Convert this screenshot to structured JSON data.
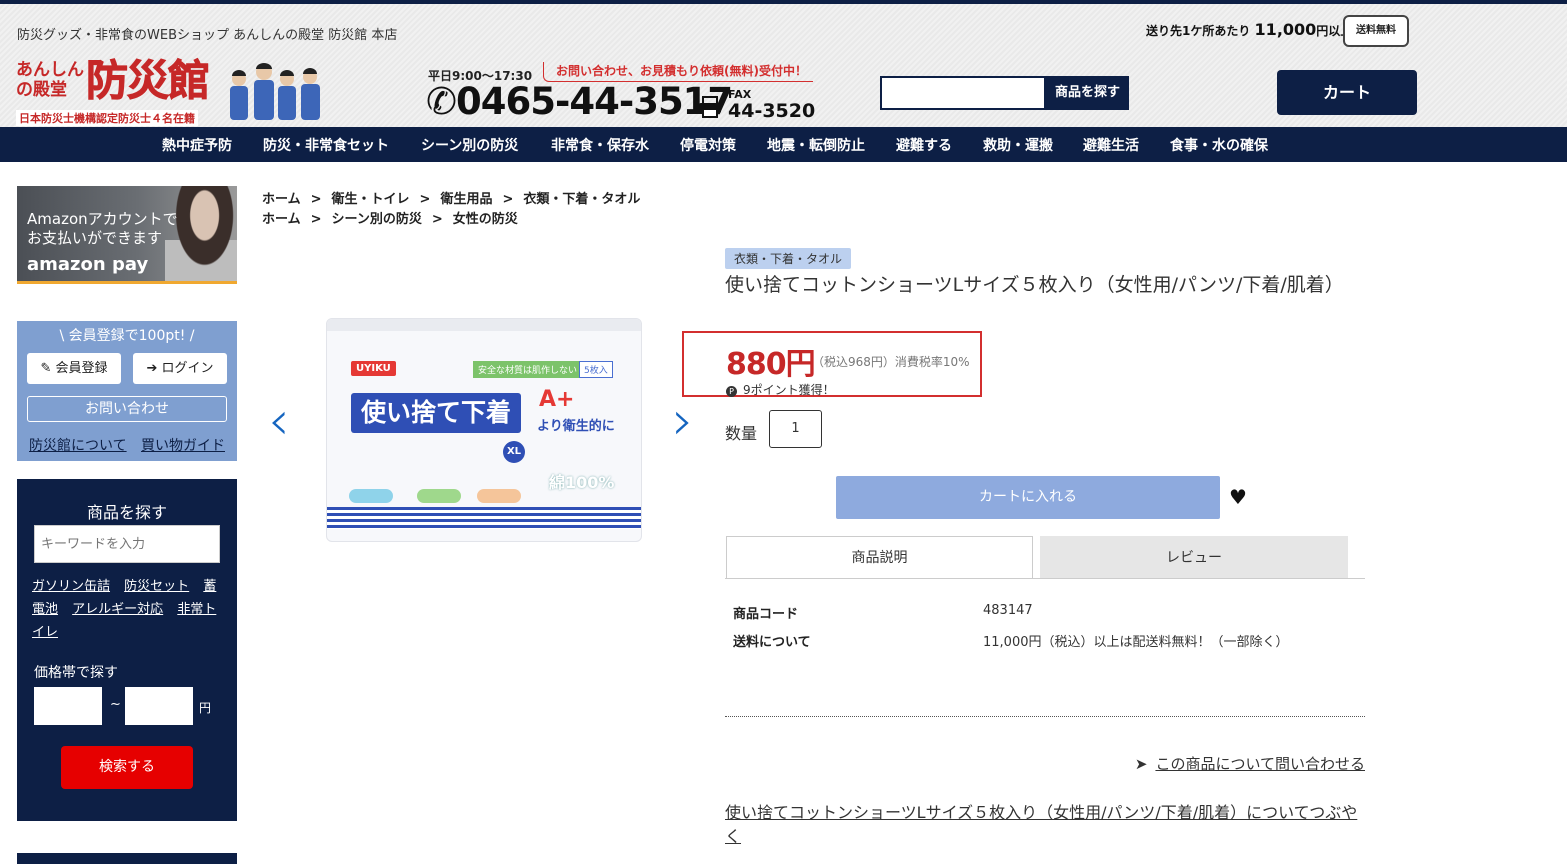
{
  "header": {
    "tagline": "防災グッズ・非常食のWEBショップ あんしんの殿堂 防災館 本店",
    "logo_small": "あんしんの殿堂",
    "logo_big": "防災館",
    "logo_sub": "日本防災士機構認定防災士４名在籍",
    "hours": "平日9:00〜17:30",
    "notice": "お問い合わせ、お見積もり依頼(無料)受付中！",
    "phone": "0465-44-3517",
    "fax_label": "FAX",
    "fax": "44-3520",
    "search_button": "商品を探す",
    "free_shipping_prefix": "送り先1ケ所あたり",
    "free_shipping_amount": "11,000",
    "free_shipping_suffix": "円以上で",
    "free_shipping_badge": "送料無料",
    "cart": "カート"
  },
  "nav": [
    "熱中症予防",
    "防災・非常食セット",
    "シーン別の防災",
    "非常食・保存水",
    "停電対策",
    "地震・転倒防止",
    "避難する",
    "救助・運搬",
    "避難生活",
    "食事・水の確保"
  ],
  "sidebar": {
    "amazon_line1": "Amazonアカウントで",
    "amazon_line2": "お支払いができます",
    "amazon_pay": "amazon pay",
    "member_title": "\\ 会員登録で100pt! /",
    "register": "会員登録",
    "login": "ログイン",
    "contact": "お問い合わせ",
    "about": "防災館について",
    "guide": "買い物ガイド",
    "find_title": "商品を探す",
    "keyword_placeholder": "キーワードを入力",
    "tags": [
      "ガソリン缶詰",
      "防災セット",
      "蓄電池",
      "アレルギー対応",
      "非常トイレ"
    ],
    "price_title": "価格帯で探す",
    "tilde": "~",
    "yen": "円",
    "search": "検索する"
  },
  "breadcrumbs": [
    [
      "ホーム",
      "衛生・トイレ",
      "衛生用品",
      "衣類・下着・タオル"
    ],
    [
      "ホーム",
      "シーン別の防災",
      "女性の防災"
    ]
  ],
  "product_image": {
    "brand": "UYIKU",
    "green_label": "安全な材質は肌作しない",
    "count": "5枚入",
    "banner": "使い捨て下着",
    "aplus": "A+",
    "side_text": "より衛生的に",
    "size": "XL",
    "cotton": "綿100%"
  },
  "product": {
    "category": "衣類・下着・タオル",
    "title": "使い捨てコットンショーツLサイズ５枚入り（女性用/パンツ/下着/肌着）",
    "price": "880円",
    "tax_note": "（税込968円）消費税率10%",
    "points_icon": "P",
    "points": "9ポイント獲得！",
    "qty_label": "数量",
    "qty": "1",
    "add_to_cart": "カートに入れる",
    "tabs": [
      "商品説明",
      "レビュー"
    ],
    "specs": [
      {
        "label": "商品コード",
        "value": "483147"
      },
      {
        "label": "送料について",
        "value": "11,000円（税込）以上は配送料無料！（一部除く）"
      }
    ],
    "inquire": "この商品について問い合わせる",
    "tweet": "使い捨てコットンショーツLサイズ５枚入り（女性用/パンツ/下着/肌着）についてつぶやく"
  }
}
